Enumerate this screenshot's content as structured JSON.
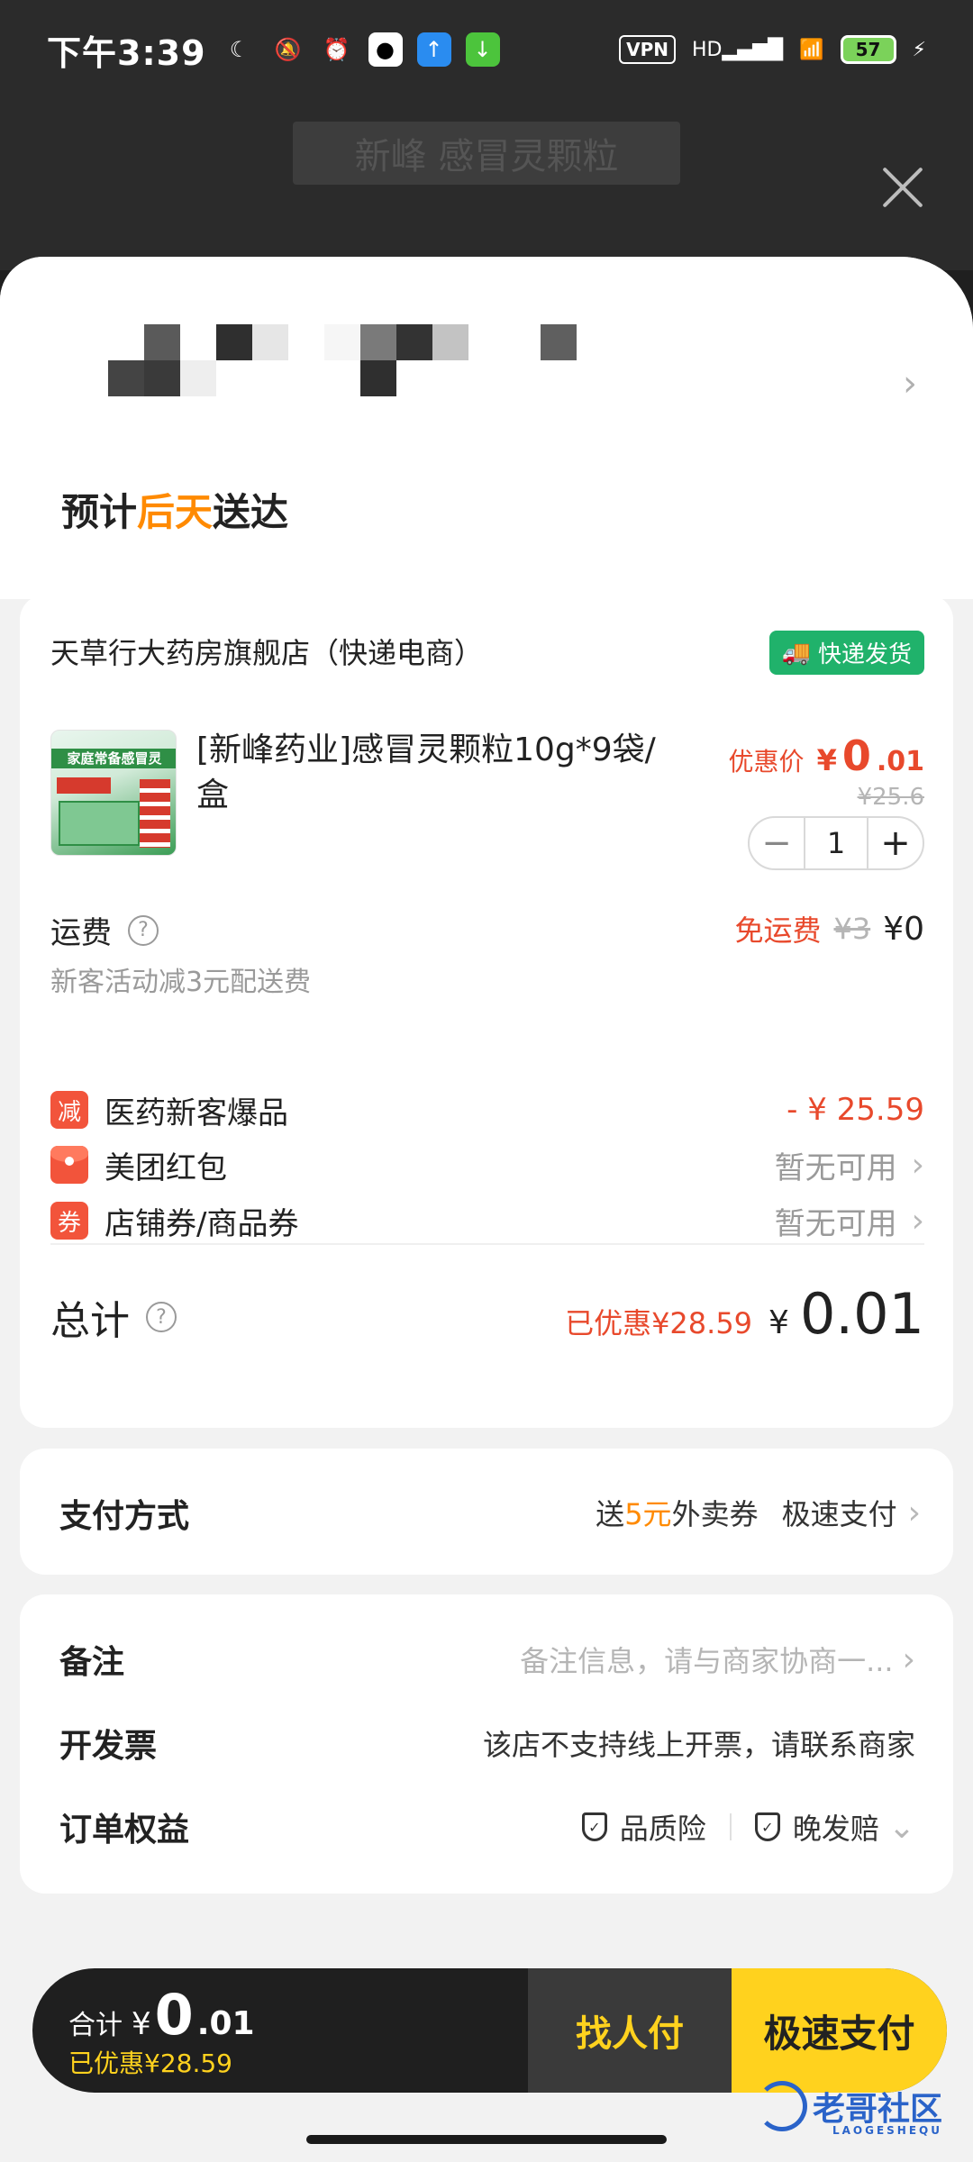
{
  "status_bar": {
    "time": "下午3:39",
    "vpn": "VPN",
    "network": "HD",
    "battery": "57"
  },
  "background_page": {
    "title": "新峰 感冒灵颗粒"
  },
  "delivery": {
    "prefix": "预计",
    "highlight": "后天",
    "suffix": "送达"
  },
  "shop": {
    "name": "天草行大药房旗舰店（快递电商）",
    "badge": "快递发货"
  },
  "product": {
    "image_band": "家庭常备感冒灵",
    "title": "[新峰药业]感冒灵颗粒10g*9袋/盒",
    "price_label": "优惠价",
    "price_symbol": "¥",
    "price_int": "0",
    "price_dec": ".01",
    "original_price": "¥25.6",
    "quantity": "1",
    "minus": "−",
    "plus": "+"
  },
  "shipping": {
    "label": "运费",
    "sub": "新客活动减3元配送费",
    "free_label": "免运费",
    "original": "¥3",
    "value": "¥0"
  },
  "discounts": {
    "new_customer": {
      "icon": "减",
      "label": "医药新客爆品",
      "value": "- ¥ 25.59"
    },
    "red_packet": {
      "label": "美团红包",
      "value": "暂无可用"
    },
    "coupon": {
      "icon": "券",
      "label": "店铺券/商品券",
      "value": "暂无可用"
    }
  },
  "total": {
    "label": "总计",
    "saved": "已优惠¥28.59",
    "symbol": "¥",
    "value": "0.01"
  },
  "payment": {
    "label": "支付方式",
    "promo_prefix": "送",
    "promo_highlight": "5元",
    "promo_suffix": "外卖券",
    "method": "极速支付"
  },
  "extras": {
    "remark_label": "备注",
    "remark_placeholder": "备注信息，请与商家协商一...",
    "invoice_label": "开发票",
    "invoice_value": "该店不支持线上开票，请联系商家",
    "rights_label": "订单权益",
    "right_1": "品质险",
    "right_2": "晚发赔"
  },
  "bottom_bar": {
    "label": "合计",
    "symbol": "¥",
    "int": "0",
    "dec": ".01",
    "saved": "已优惠¥28.59",
    "ask_button": "找人付",
    "pay_button": "极速支付"
  },
  "watermark": {
    "text": "老哥社区",
    "sub": "LAOGESHEQU"
  },
  "colors": {
    "accent_orange": "#ff8a00",
    "price_red": "#e8492c",
    "pay_yellow": "#ffd21e",
    "express_green": "#20b26b"
  }
}
